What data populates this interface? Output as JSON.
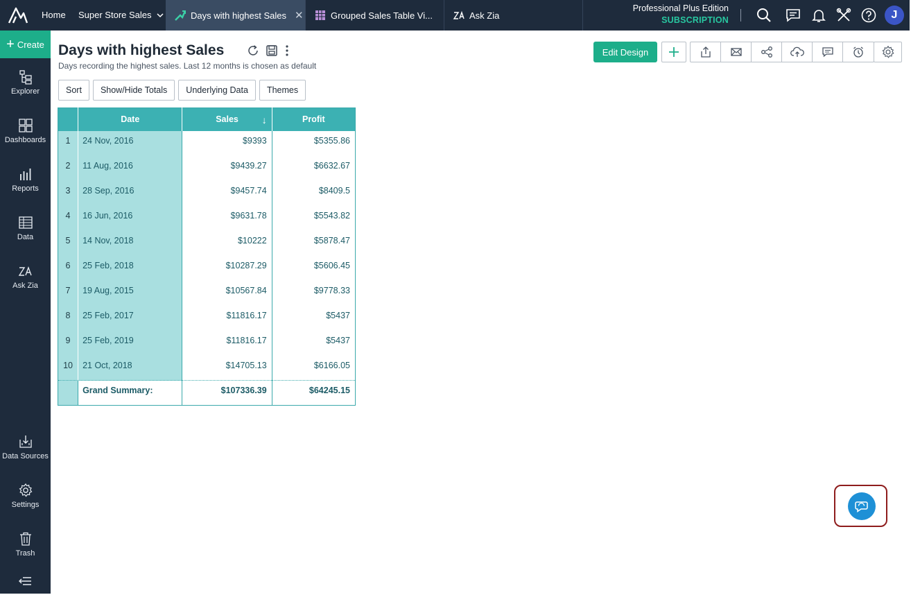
{
  "topbar": {
    "home": "Home",
    "workspace": "Super Store Sales",
    "tabs": [
      {
        "label": "Days with highest Sales",
        "active": true
      },
      {
        "label": "Grouped Sales Table Vi...",
        "active": false
      },
      {
        "label": "Ask Zia",
        "active": false
      }
    ],
    "edition": "Professional Plus Edition",
    "subscription": "SUBSCRIPTION",
    "avatar": "J"
  },
  "sidebar": {
    "create": "Create",
    "items": [
      {
        "label": "Explorer",
        "icon": "explorer-icon"
      },
      {
        "label": "Dashboards",
        "icon": "dashboards-icon"
      },
      {
        "label": "Reports",
        "icon": "reports-icon"
      },
      {
        "label": "Data",
        "icon": "data-icon"
      },
      {
        "label": "Ask Zia",
        "icon": "zia-icon"
      }
    ],
    "bottom_items": [
      {
        "label": "Data Sources",
        "icon": "data-sources-icon"
      },
      {
        "label": "Settings",
        "icon": "gear-icon"
      },
      {
        "label": "Trash",
        "icon": "trash-icon"
      }
    ]
  },
  "report": {
    "title": "Days with highest Sales",
    "description": "Days recording the highest sales. Last 12 months is chosen as default",
    "toolbar": [
      "Sort",
      "Show/Hide Totals",
      "Underlying Data",
      "Themes"
    ],
    "edit_design": "Edit Design"
  },
  "table": {
    "columns": [
      "Date",
      "Sales",
      "Profit"
    ],
    "rows": [
      {
        "index": "1",
        "date": "24 Nov, 2016",
        "sales": "$9393",
        "profit": "$5355.86"
      },
      {
        "index": "2",
        "date": "11 Aug, 2016",
        "sales": "$9439.27",
        "profit": "$6632.67"
      },
      {
        "index": "3",
        "date": "28 Sep, 2016",
        "sales": "$9457.74",
        "profit": "$8409.5"
      },
      {
        "index": "4",
        "date": "16 Jun, 2016",
        "sales": "$9631.78",
        "profit": "$5543.82"
      },
      {
        "index": "5",
        "date": "14 Nov, 2018",
        "sales": "$10222",
        "profit": "$5878.47"
      },
      {
        "index": "6",
        "date": "25 Feb, 2018",
        "sales": "$10287.29",
        "profit": "$5606.45"
      },
      {
        "index": "7",
        "date": "19 Aug, 2015",
        "sales": "$10567.84",
        "profit": "$9778.33"
      },
      {
        "index": "8",
        "date": "25 Feb, 2017",
        "sales": "$11816.17",
        "profit": "$5437"
      },
      {
        "index": "9",
        "date": "25 Feb, 2019",
        "sales": "$11816.17",
        "profit": "$5437"
      },
      {
        "index": "10",
        "date": "21 Oct, 2018",
        "sales": "$14705.13",
        "profit": "$6166.05"
      }
    ],
    "summary": {
      "label": "Grand Summary:",
      "sales": "$107336.39",
      "profit": "$64245.15"
    }
  },
  "colors": {
    "topbar": "#1e2b3c",
    "accent": "#1dae8a",
    "table_header": "#3cb1b3",
    "table_highlight": "#a9dfe0",
    "chat": "#1e90d6"
  }
}
